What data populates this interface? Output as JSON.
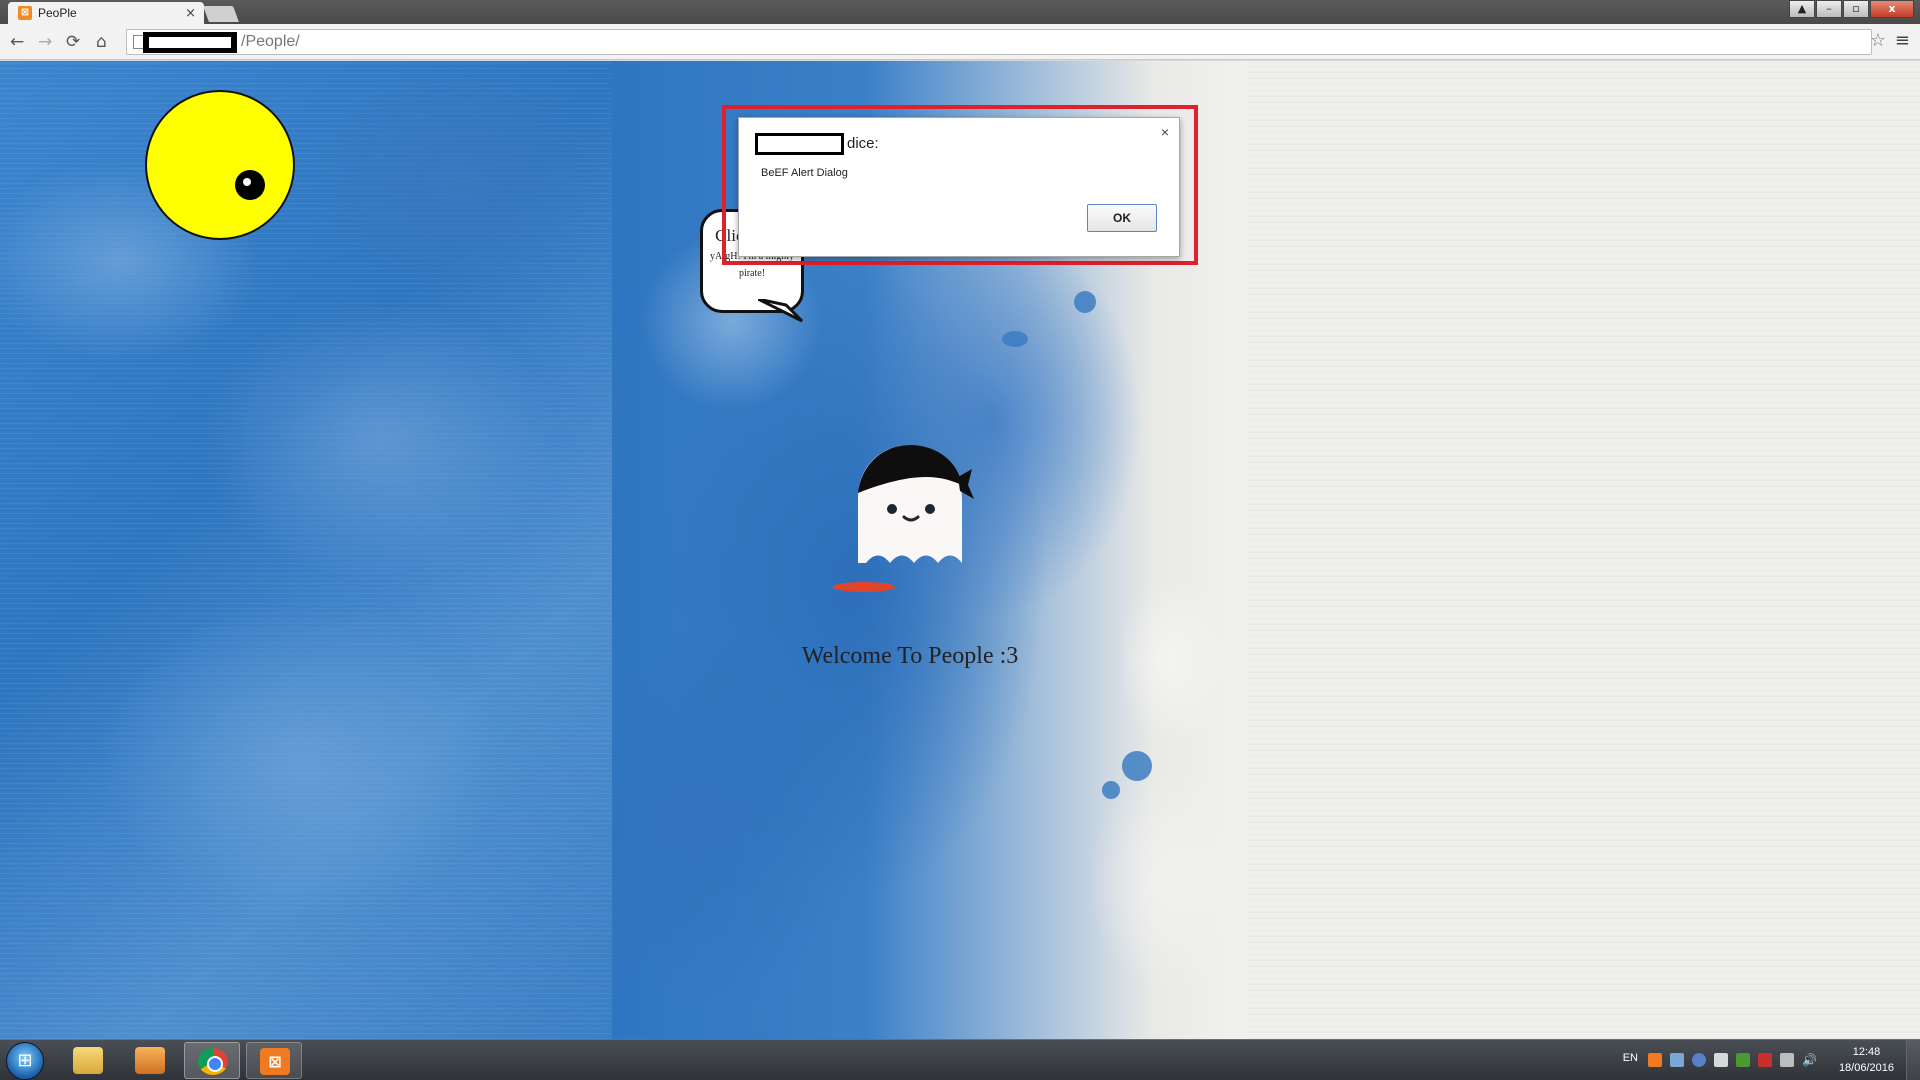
{
  "browser": {
    "tab_title": "PeoPle",
    "tab_close": "×",
    "url_path": "/People/",
    "star": "☆",
    "menu": "≡",
    "nav": {
      "back": "←",
      "forward": "→",
      "reload": "⟳",
      "home": "⌂"
    }
  },
  "window_controls": {
    "user": "▲",
    "minimize": "–",
    "restore": "▫",
    "close": "x"
  },
  "page": {
    "bubble_title": "Click Me !",
    "bubble_text": "yArgH! I'm a mighty pirate!",
    "welcome": "Welcome To People :3"
  },
  "alert": {
    "origin_suffix": "dice:",
    "message": "BeEF Alert Dialog",
    "ok_label": "OK",
    "close": "×"
  },
  "taskbar": {
    "language": "EN",
    "time": "12:48",
    "date": "18/06/2016",
    "apps": [
      "windows-explorer",
      "media-player",
      "google-chrome",
      "xampp"
    ]
  },
  "colors": {
    "highlight_red": "#e0202a",
    "yellow_eye": "#ffff00",
    "splash_blue": "#2e76c0",
    "ghost_shadow": "#e0452a"
  }
}
